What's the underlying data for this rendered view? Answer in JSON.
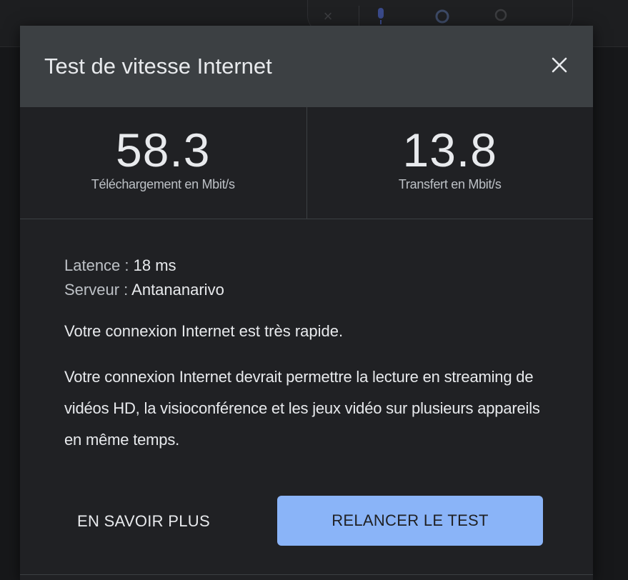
{
  "dialog": {
    "title": "Test de vitesse Internet",
    "close_icon": "close-icon"
  },
  "metrics": {
    "download": {
      "value": "58.3",
      "label": "Téléchargement en Mbit/s"
    },
    "upload": {
      "value": "13.8",
      "label": "Transfert en Mbit/s"
    }
  },
  "details": {
    "latency_label": "Latence : ",
    "latency_value": "18 ms",
    "server_label": "Serveur : ",
    "server_value": "Antananarivo"
  },
  "verdict": "Votre connexion Internet est très rapide.",
  "description": "Votre connexion Internet devrait permettre la lecture en streaming de vidéos HD, la visioconférence et les jeux vidéo sur plusieurs appareils en même temps.",
  "actions": {
    "learn_more": "EN SAVOIR PLUS",
    "rerun": "RELANCER LE TEST"
  },
  "colors": {
    "accent": "#8ab4f8",
    "dialog_bg": "#202124",
    "header_bg": "#3c4043",
    "text": "#e8eaed"
  }
}
